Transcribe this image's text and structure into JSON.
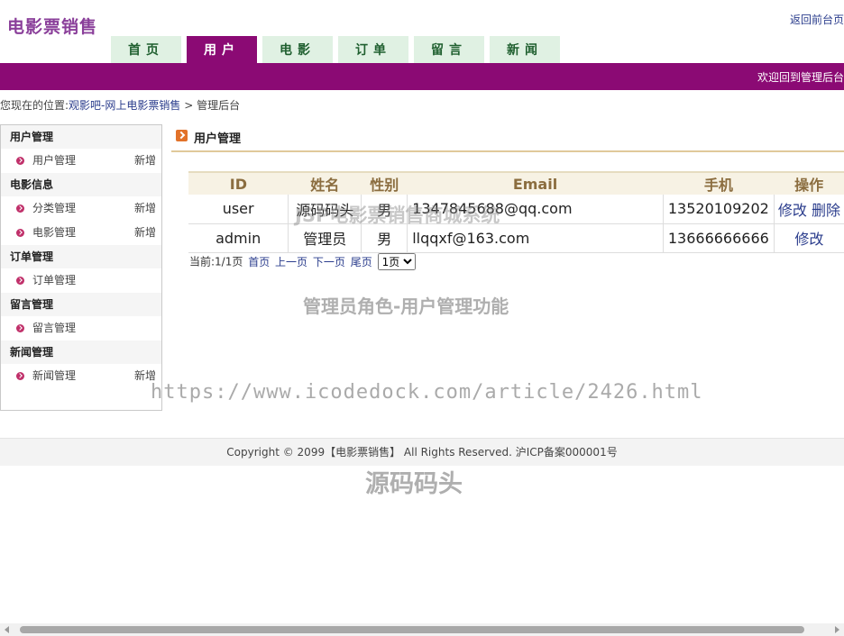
{
  "header": {
    "site_title": "电影票销售",
    "back_link": "返回前台页",
    "welcome": "欢迎回到管理后台"
  },
  "nav": {
    "tabs": [
      {
        "label": "首页",
        "active": false
      },
      {
        "label": "用户",
        "active": true
      },
      {
        "label": "电影",
        "active": false
      },
      {
        "label": "订单",
        "active": false
      },
      {
        "label": "留言",
        "active": false
      },
      {
        "label": "新闻",
        "active": false
      }
    ]
  },
  "breadcrumb": {
    "prefix": "您现在的位置:",
    "home": "观影吧-网上电影票销售",
    "separator": ">",
    "current": "管理后台"
  },
  "sidebar": {
    "groups": [
      {
        "title": "用户管理",
        "items": [
          {
            "label": "用户管理",
            "add": "新增"
          }
        ]
      },
      {
        "title": "电影信息",
        "items": [
          {
            "label": "分类管理",
            "add": "新增"
          },
          {
            "label": "电影管理",
            "add": "新增"
          }
        ]
      },
      {
        "title": "订单管理",
        "items": [
          {
            "label": "订单管理",
            "add": ""
          }
        ]
      },
      {
        "title": "留言管理",
        "items": [
          {
            "label": "留言管理",
            "add": ""
          }
        ]
      },
      {
        "title": "新闻管理",
        "items": [
          {
            "label": "新闻管理",
            "add": "新增"
          }
        ]
      }
    ]
  },
  "main": {
    "heading": "用户管理",
    "table": {
      "headers": [
        "ID",
        "姓名",
        "性别",
        "Email",
        "手机",
        "操作"
      ],
      "rows": [
        {
          "id": "user",
          "name": "源码码头",
          "gender": "男",
          "email": "1347845688@qq.com",
          "phone": "13520109202",
          "edit": "修改",
          "delete": "删除"
        },
        {
          "id": "admin",
          "name": "管理员",
          "gender": "男",
          "email": "llqqxf@163.com",
          "phone": "13666666666",
          "edit": "修改",
          "delete": ""
        }
      ]
    },
    "pager": {
      "info": "当前:1/1页",
      "first": "首页",
      "prev": "上一页",
      "next": "下一页",
      "last": "尾页",
      "select_value": "1页"
    }
  },
  "watermarks": {
    "line1": "JSP电影票销售商城系统",
    "line2": "管理员角色-用户管理功能",
    "line3": "https://www.icodedock.com/article/2426.html",
    "line4": "源码码头"
  },
  "footer": {
    "text": "Copyright © 2099【电影票销售】 All Rights Reserved. 沪ICP备案000001号"
  },
  "colors": {
    "brand_purple": "#8b0a74",
    "tab_green": "#e0f1e3",
    "title_purple": "#8a3f9a",
    "link_blue": "#2a3c8c"
  }
}
